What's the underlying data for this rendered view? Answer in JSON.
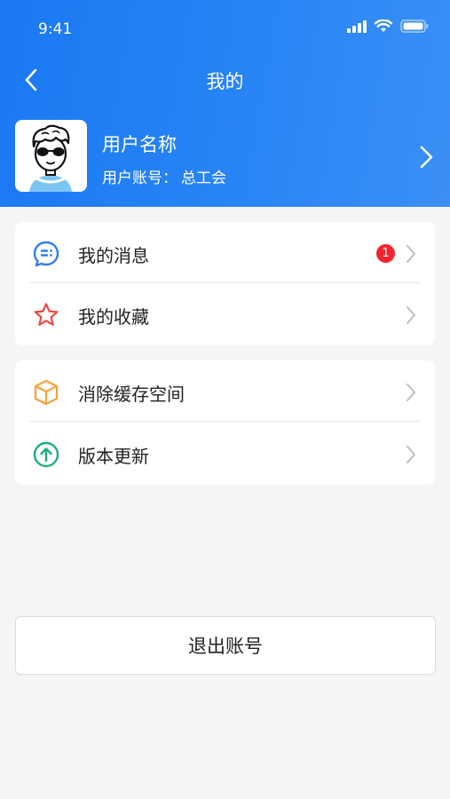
{
  "status_bar": {
    "time": "9:41"
  },
  "nav": {
    "title": "我的"
  },
  "profile": {
    "name": "用户名称",
    "account_label": "用户账号：",
    "account_value": "总工会"
  },
  "menu_group_1": [
    {
      "label": "我的消息",
      "icon": "message-icon",
      "badge": "1"
    },
    {
      "label": "我的收藏",
      "icon": "star-icon"
    }
  ],
  "menu_group_2": [
    {
      "label": "消除缓存空间",
      "icon": "box-icon"
    },
    {
      "label": "版本更新",
      "icon": "upgrade-icon"
    }
  ],
  "logout": {
    "label": "退出账号"
  },
  "colors": {
    "header_blue": "#1a78f2",
    "badge_red": "#f0262f",
    "icon_blue": "#2f7ef4",
    "icon_red": "#f0483e",
    "icon_orange": "#f5a13a",
    "icon_green": "#1fae7a"
  }
}
